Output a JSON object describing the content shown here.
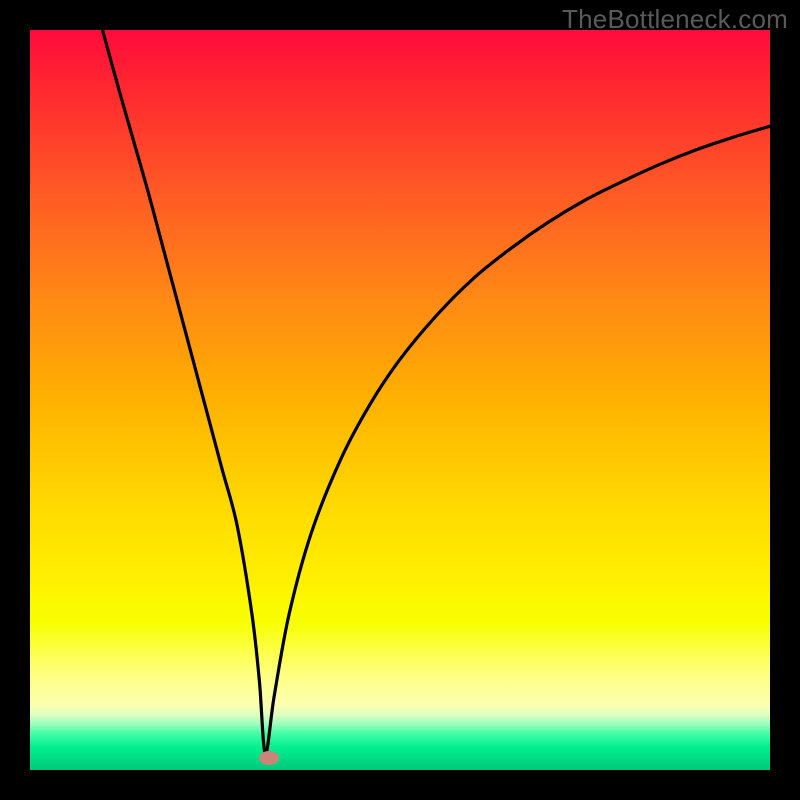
{
  "attribution": "TheBottleneck.com",
  "colors": {
    "frame": "#000000",
    "top_gradient": "#ff0b3b",
    "bottom_gradient": "#00c97a",
    "curve": "#000000",
    "marker": "#cb8578"
  },
  "chart_data": {
    "type": "line",
    "title": "",
    "xlabel": "",
    "ylabel": "",
    "xlim": [
      0,
      100
    ],
    "ylim": [
      0,
      100
    ],
    "grid": false,
    "legend": false,
    "annotations": [],
    "series": [
      {
        "name": "bottleneck-curve",
        "x": [
          9.8,
          12,
          14,
          16,
          18,
          20,
          22,
          24,
          26,
          28,
          30,
          31,
          31.8,
          33,
          35,
          38,
          42,
          46,
          50,
          55,
          60,
          65,
          70,
          75,
          80,
          85,
          90,
          95,
          100
        ],
        "y": [
          100,
          92,
          85,
          78,
          70.5,
          63,
          55.5,
          48,
          40.5,
          33,
          21,
          12,
          2.2,
          10,
          21,
          32,
          42,
          49.5,
          55.5,
          61.5,
          66.5,
          70.5,
          74,
          77,
          79.5,
          81.8,
          83.8,
          85.5,
          87
        ]
      }
    ],
    "marker": {
      "x": 32.3,
      "y": 1.6
    }
  }
}
